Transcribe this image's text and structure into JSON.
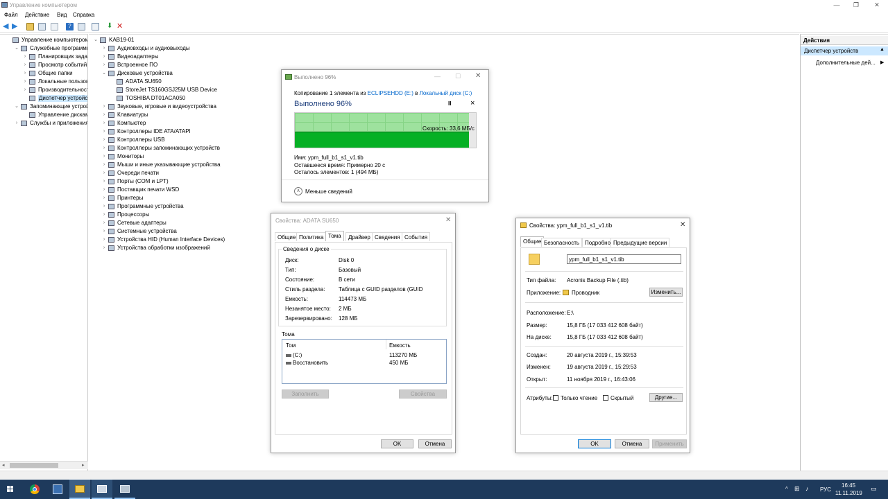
{
  "window": {
    "title": "Управление компьютером"
  },
  "menu": [
    "Файл",
    "Действие",
    "Вид",
    "Справка"
  ],
  "left_tree": [
    {
      "label": "Управление компьютером (л",
      "level": 0,
      "exp": ""
    },
    {
      "label": "Служебные программы",
      "level": 1,
      "exp": "v"
    },
    {
      "label": "Планировщик заданий",
      "level": 2,
      "exp": ">"
    },
    {
      "label": "Просмотр событий",
      "level": 2,
      "exp": ">"
    },
    {
      "label": "Общие папки",
      "level": 2,
      "exp": ">"
    },
    {
      "label": "Локальные пользовате",
      "level": 2,
      "exp": ">"
    },
    {
      "label": "Производительность",
      "level": 2,
      "exp": ">"
    },
    {
      "label": "Диспетчер устройств",
      "level": 2,
      "exp": "",
      "selected": true
    },
    {
      "label": "Запоминающие устройст",
      "level": 1,
      "exp": "v"
    },
    {
      "label": "Управление дисками",
      "level": 2,
      "exp": ""
    },
    {
      "label": "Службы и приложения",
      "level": 1,
      "exp": ">"
    }
  ],
  "device_tree": [
    {
      "label": "KAB19-01",
      "level": 0,
      "exp": "v"
    },
    {
      "label": "Аудиовходы и аудиовыходы",
      "level": 1,
      "exp": ">"
    },
    {
      "label": "Видеоадаптеры",
      "level": 1,
      "exp": ">"
    },
    {
      "label": "Встроенное ПО",
      "level": 1,
      "exp": ">"
    },
    {
      "label": "Дисковые устройства",
      "level": 1,
      "exp": "v"
    },
    {
      "label": "ADATA SU650",
      "level": 2,
      "exp": ""
    },
    {
      "label": "StoreJet TS160GSJ25M USB Device",
      "level": 2,
      "exp": ""
    },
    {
      "label": "TOSHIBA DT01ACA050",
      "level": 2,
      "exp": ""
    },
    {
      "label": "Звуковые, игровые и видеоустройства",
      "level": 1,
      "exp": ">"
    },
    {
      "label": "Клавиатуры",
      "level": 1,
      "exp": ">"
    },
    {
      "label": "Компьютер",
      "level": 1,
      "exp": ">"
    },
    {
      "label": "Контроллеры IDE ATA/ATAPI",
      "level": 1,
      "exp": ">"
    },
    {
      "label": "Контроллеры USB",
      "level": 1,
      "exp": ">"
    },
    {
      "label": "Контроллеры запоминающих устройств",
      "level": 1,
      "exp": ">"
    },
    {
      "label": "Мониторы",
      "level": 1,
      "exp": ">"
    },
    {
      "label": "Мыши и иные указывающие устройства",
      "level": 1,
      "exp": ">"
    },
    {
      "label": "Очереди печати",
      "level": 1,
      "exp": ">"
    },
    {
      "label": "Порты (COM и LPT)",
      "level": 1,
      "exp": ">"
    },
    {
      "label": "Поставщик печати WSD",
      "level": 1,
      "exp": ">"
    },
    {
      "label": "Принтеры",
      "level": 1,
      "exp": ">"
    },
    {
      "label": "Программные устройства",
      "level": 1,
      "exp": ">"
    },
    {
      "label": "Процессоры",
      "level": 1,
      "exp": ">"
    },
    {
      "label": "Сетевые адаптеры",
      "level": 1,
      "exp": ">"
    },
    {
      "label": "Системные устройства",
      "level": 1,
      "exp": ">"
    },
    {
      "label": "Устройства HID (Human Interface Devices)",
      "level": 1,
      "exp": ">"
    },
    {
      "label": "Устройства обработки изображений",
      "level": 1,
      "exp": ">"
    }
  ],
  "actions": {
    "header": "Действия",
    "section": "Диспетчер устройств",
    "item": "Дополнительные дей..."
  },
  "copy_dialog": {
    "title": "Выполнено 96%",
    "line_prefix": "Копирование 1 элемента из ",
    "source": "ECLIPSEHDD (E:)",
    "in": " в ",
    "dest": "Локальный диск (C:)",
    "heading": "Выполнено 96%",
    "progress": 96,
    "speed": "Скорость: 33,6 МБ/с",
    "name_label": "Имя:",
    "name_value": "ypm_full_b1_s1_v1.tib",
    "time_label": "Оставшееся время:",
    "time_value": "Примерно 20 с",
    "items_label": "Осталось элементов:",
    "items_value": "1 (494 МБ)",
    "less": "Меньше сведений",
    "pause_icon": "II",
    "close_icon": "×"
  },
  "adata_dialog": {
    "title": "Свойства: ADATA SU650",
    "tabs": [
      "Общие",
      "Политика",
      "Тома",
      "Драйвер",
      "Сведения",
      "События"
    ],
    "active_tab": "Тома",
    "group_title": "Сведения о диске",
    "fields": [
      {
        "label": "Диск:",
        "value": "Disk 0"
      },
      {
        "label": "Тип:",
        "value": "Базовый"
      },
      {
        "label": "Состояние:",
        "value": "В сети"
      },
      {
        "label": "Стиль раздела:",
        "value": "Таблица с GUID разделов (GUID"
      },
      {
        "label": "Емкость:",
        "value": "114473 МБ"
      },
      {
        "label": "Незанятое место:",
        "value": "2 МБ"
      },
      {
        "label": "Зарезервировано:",
        "value": "128 МБ"
      }
    ],
    "volumes_title": "Тома",
    "col_volume": "Том",
    "col_capacity": "Емкость",
    "volumes": [
      {
        "name": "(C:)",
        "capacity": "113270 МБ"
      },
      {
        "name": "Восстановить",
        "capacity": "450 МБ"
      }
    ],
    "btn_fill": "Заполнить",
    "btn_props": "Свойства",
    "ok": "OK",
    "cancel": "Отмена"
  },
  "file_dialog": {
    "title": "Свойства: ypm_full_b1_s1_v1.tib",
    "tabs": [
      "Общие",
      "Безопасность",
      "Подробно",
      "Предыдущие версии"
    ],
    "active_tab": "Общие",
    "filename": "ypm_full_b1_s1_v1.tib",
    "type_label": "Тип файла:",
    "type_value": "Acronis Backup File (.tib)",
    "app_label": "Приложение:",
    "app_value": "Проводник",
    "change": "Изменить...",
    "loc_label": "Расположение:",
    "loc_value": "E:\\",
    "size_label": "Размер:",
    "size_value": "15,8 ГБ (17 033 412 608 байт)",
    "disk_label": "На диске:",
    "disk_value": "15,8 ГБ (17 033 412 608 байт)",
    "created_label": "Создан:",
    "created_value": "20 августа 2019 г., 15:39:53",
    "modified_label": "Изменен:",
    "modified_value": "19 августа 2019 г., 15:29:53",
    "opened_label": "Открыт:",
    "opened_value": "11 ноября 2019 г., 16:43:06",
    "attr_label": "Атрибуты:",
    "readonly": "Только чтение",
    "hidden": "Скрытый",
    "other": "Другие...",
    "ok": "OK",
    "cancel": "Отмена",
    "apply": "Применить"
  },
  "taskbar": {
    "lang": "РУС",
    "time": "16:45",
    "date": "11.11.2019"
  },
  "colors": {
    "progress_fill": "#06b025",
    "progress_bg": "#9ee29e",
    "link": "#0066cc",
    "taskbar": "#1e3a5c",
    "selected": "#cce8ff"
  }
}
